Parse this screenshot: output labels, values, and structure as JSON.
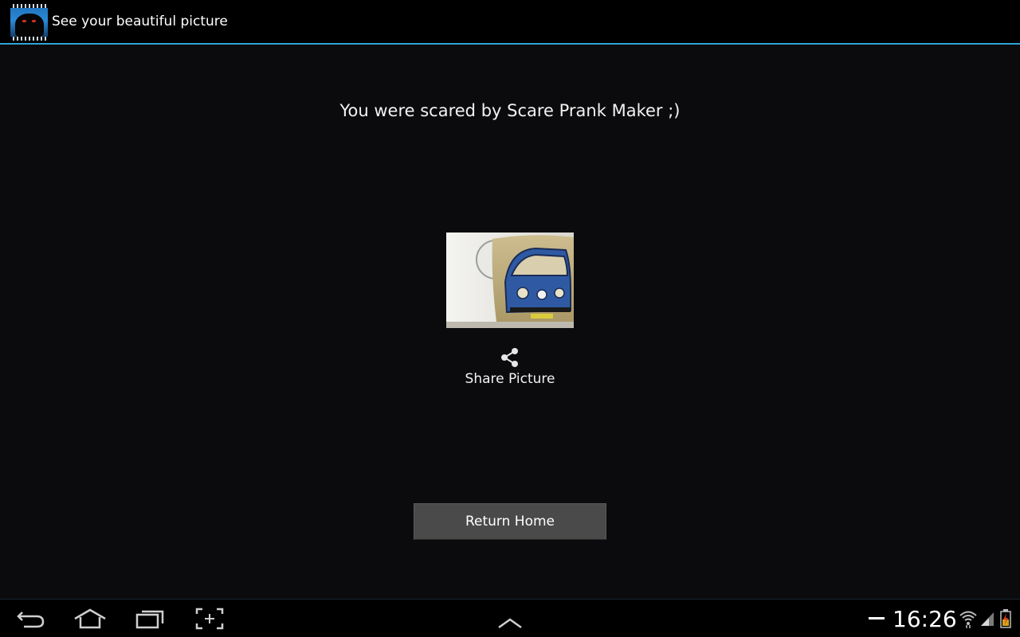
{
  "action_bar": {
    "title": "See your beautiful picture",
    "app_icon": "app-icon-monster"
  },
  "main": {
    "message": "You were scared by Scare Prank Maker ;)",
    "photo_alt": "captured-photo",
    "share_icon": "share-icon",
    "share_label": "Share Picture",
    "return_home_label": "Return Home"
  },
  "system_bar": {
    "back_icon": "back-icon",
    "home_icon": "home-icon",
    "recent_apps_icon": "recent-apps-icon",
    "screenshot_icon": "screenshot-icon",
    "menu_up_icon": "chevron-up-icon",
    "time": "16:26",
    "wifi_icon": "wifi-icon",
    "signal_icon": "signal-icon",
    "battery_icon": "battery-icon"
  },
  "colors": {
    "background": "#0b0b0d",
    "accent_line": "#2fa4d6",
    "button": "#4a4a4a"
  }
}
